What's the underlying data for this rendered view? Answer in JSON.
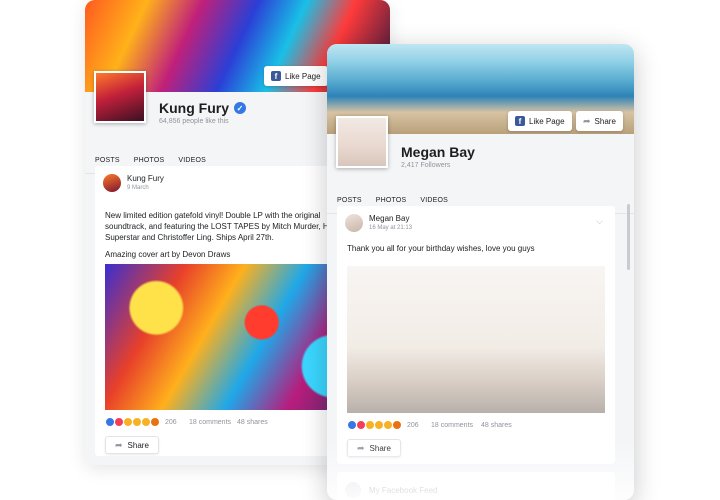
{
  "back_widget": {
    "like_page_label": "Like Page",
    "page_name": "Kung Fury",
    "page_sub": "64,856 people like this",
    "tabs": [
      "POSTS",
      "PHOTOS",
      "VIDEOS"
    ],
    "post": {
      "author": "Kung Fury",
      "date": "9 March",
      "text_lines": [
        "New limited edition gatefold vinyl! Double LP with the original",
        "soundtrack, and featuring the LOST TAPES by Mitch Murder, Hig",
        "Superstar and Christoffer Ling. Ships April 27th."
      ],
      "text_extra": "Amazing cover art by Devon Draws",
      "reaction_count": "206",
      "comments": "18 comments",
      "shares": "48 shares",
      "share_label": "Share"
    }
  },
  "front_widget": {
    "like_page_label": "Like Page",
    "share_label": "Share",
    "page_name": "Megan Bay",
    "page_sub": "2,417 Followers",
    "tabs": [
      "POSTS",
      "PHOTOS",
      "VIDEOS"
    ],
    "post": {
      "author": "Megan Bay",
      "date": "16 May at 21:13",
      "text": "Thank you all for your birthday wishes, love you guys",
      "reaction_count": "206",
      "comments": "18 comments",
      "shares": "48 shares",
      "share_label": "Share"
    },
    "next_post_title": "My Facebook Feed"
  },
  "colors": {
    "facebook_blue": "#3b5998",
    "verified_blue": "#3578e5",
    "panel_bg": "#f4f5f7"
  }
}
